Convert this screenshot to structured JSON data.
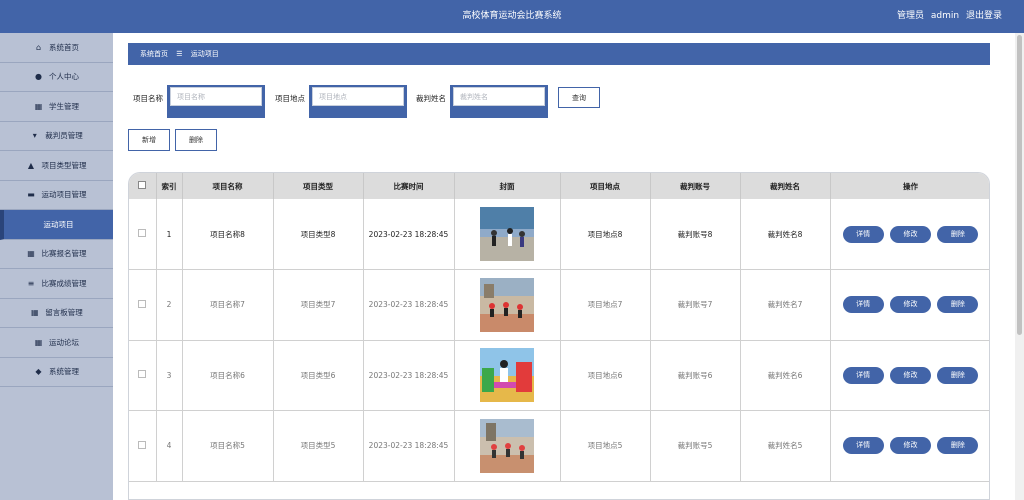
{
  "header": {
    "title": "高校体育运动会比赛系统",
    "role": "管理员",
    "username": "admin",
    "logout_label": "退出登录"
  },
  "sidebar": {
    "items": [
      {
        "label": "系统首页",
        "icon": "home-icon",
        "glyph": "⌂"
      },
      {
        "label": "个人中心",
        "icon": "user-icon",
        "glyph": "●"
      },
      {
        "label": "学生管理",
        "icon": "grid-icon",
        "glyph": "▦"
      },
      {
        "label": "裁判员管理",
        "icon": "flag-icon",
        "glyph": "▾"
      },
      {
        "label": "项目类型管理",
        "icon": "thumb-icon",
        "glyph": "▲"
      },
      {
        "label": "运动项目管理",
        "icon": "printer-icon",
        "glyph": "▬"
      },
      {
        "label": "运动项目",
        "sub": true
      },
      {
        "label": "比赛报名管理",
        "icon": "grid-icon",
        "glyph": "▦"
      },
      {
        "label": "比赛成绩管理",
        "icon": "list-icon",
        "glyph": "≡"
      },
      {
        "label": "留言板管理",
        "icon": "grid-icon",
        "glyph": "▦"
      },
      {
        "label": "运动论坛",
        "icon": "grid-icon",
        "glyph": "▦"
      },
      {
        "label": "系统管理",
        "icon": "pin-icon",
        "glyph": "◆"
      }
    ]
  },
  "breadcrumb": {
    "home": "系统首页",
    "separator": "☰",
    "current": "运动项目"
  },
  "search": {
    "name_label": "项目名称",
    "name_placeholder": "项目名称",
    "location_label": "项目地点",
    "location_placeholder": "项目地点",
    "referee_label": "裁判姓名",
    "referee_placeholder": "裁判姓名",
    "query_label": "查询"
  },
  "actions": {
    "add_label": "新增",
    "delete_label": "删除"
  },
  "table": {
    "headers": [
      "索引",
      "项目名称",
      "项目类型",
      "比赛时间",
      "封面",
      "项目地点",
      "裁判账号",
      "裁判姓名",
      "操作"
    ],
    "op_labels": {
      "detail": "详情",
      "edit": "修改",
      "delete": "删除"
    },
    "rows": [
      {
        "index": "1",
        "name": "项目名称8",
        "type": "项目类型8",
        "time": "2023-02-23 18:28:45",
        "location": "项目地点8",
        "referee_account": "裁判账号8",
        "referee_name": "裁判姓名8"
      },
      {
        "index": "2",
        "name": "项目名称7",
        "type": "项目类型7",
        "time": "2023-02-23 18:28:45",
        "location": "项目地点7",
        "referee_account": "裁判账号7",
        "referee_name": "裁判姓名7"
      },
      {
        "index": "3",
        "name": "项目名称6",
        "type": "项目类型6",
        "time": "2023-02-23 18:28:45",
        "location": "项目地点6",
        "referee_account": "裁判账号6",
        "referee_name": "裁判姓名6"
      },
      {
        "index": "4",
        "name": "项目名称5",
        "type": "项目类型5",
        "time": "2023-02-23 18:28:45",
        "location": "项目地点5",
        "referee_account": "裁判账号5",
        "referee_name": "裁判姓名5"
      }
    ]
  },
  "colors": {
    "primary": "#4264a8",
    "sidebar_bg": "#b8c1d4",
    "header_row": "#dcdcdc"
  }
}
